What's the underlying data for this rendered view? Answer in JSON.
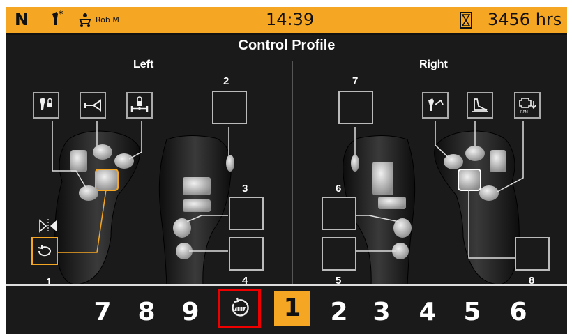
{
  "statusbar": {
    "gear": "N",
    "operator_name": "Rob M",
    "clock": "14:39",
    "hours": "3456 hrs"
  },
  "title": "Control Profile",
  "sides": {
    "left": "Left",
    "right": "Right"
  },
  "buttons": {
    "left_mode": "1",
    "left_top": "2",
    "left_mid": "3",
    "left_bottom": "4",
    "right_top": "7",
    "right_mid": "6",
    "right_lower": "5",
    "right_bottom": "8"
  },
  "profiles": {
    "before": [
      "7",
      "8",
      "9"
    ],
    "active": "1",
    "after": [
      "2",
      "3",
      "4",
      "5",
      "6"
    ]
  },
  "colors": {
    "accent": "#f5a623",
    "highlight": "#e00000",
    "background": "#1a1a1a"
  },
  "icons": {
    "left_assign": [
      "joystick-lock-icon",
      "horn-icon",
      "axle-lock-icon"
    ],
    "right_assign": [
      "joystick-arm-icon",
      "bucket-icon",
      "engine-rpm-icon"
    ],
    "mode": "rotate-icon",
    "mirror": "mirror-icon",
    "swap": "swap-profile-icon"
  }
}
